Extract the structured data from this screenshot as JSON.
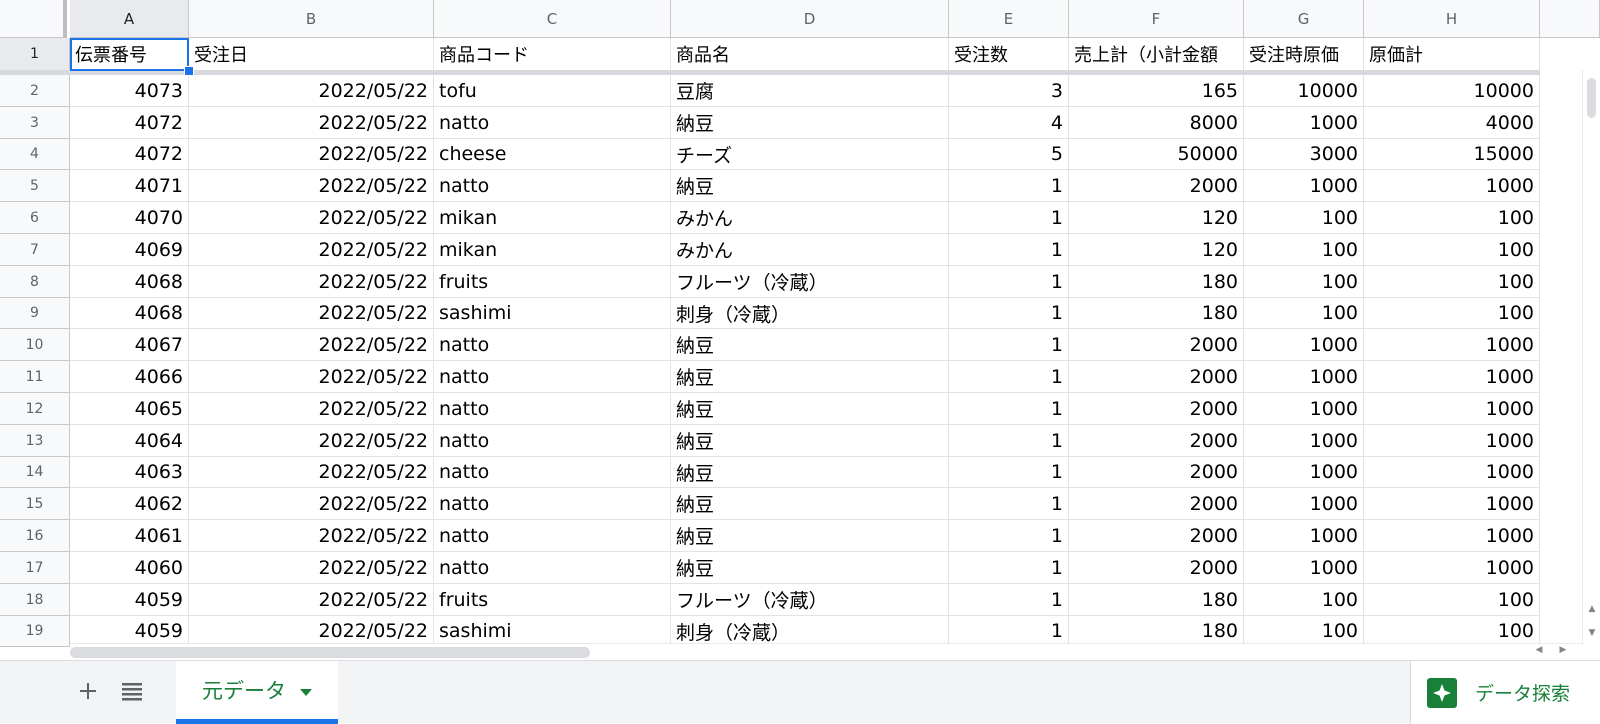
{
  "columns": [
    "A",
    "B",
    "C",
    "D",
    "E",
    "F",
    "G",
    "H"
  ],
  "header_row": {
    "number": "1",
    "cells": [
      "伝票番号",
      "受注日",
      "商品コード",
      "商品名",
      "受注数",
      "売上計（小計金額",
      "受注時原価",
      "原価計"
    ]
  },
  "rows": [
    {
      "n": "2",
      "cells": [
        "4073",
        "2022/05/22",
        "tofu",
        "豆腐",
        "3",
        "165",
        "10000",
        "10000"
      ]
    },
    {
      "n": "3",
      "cells": [
        "4072",
        "2022/05/22",
        "natto",
        "納豆",
        "4",
        "8000",
        "1000",
        "4000"
      ]
    },
    {
      "n": "4",
      "cells": [
        "4072",
        "2022/05/22",
        "cheese",
        "チーズ",
        "5",
        "50000",
        "3000",
        "15000"
      ]
    },
    {
      "n": "5",
      "cells": [
        "4071",
        "2022/05/22",
        "natto",
        "納豆",
        "1",
        "2000",
        "1000",
        "1000"
      ]
    },
    {
      "n": "6",
      "cells": [
        "4070",
        "2022/05/22",
        "mikan",
        "みかん",
        "1",
        "120",
        "100",
        "100"
      ]
    },
    {
      "n": "7",
      "cells": [
        "4069",
        "2022/05/22",
        "mikan",
        "みかん",
        "1",
        "120",
        "100",
        "100"
      ]
    },
    {
      "n": "8",
      "cells": [
        "4068",
        "2022/05/22",
        "fruits",
        "フルーツ（冷蔵）",
        "1",
        "180",
        "100",
        "100"
      ]
    },
    {
      "n": "9",
      "cells": [
        "4068",
        "2022/05/22",
        "sashimi",
        "刺身（冷蔵）",
        "1",
        "180",
        "100",
        "100"
      ]
    },
    {
      "n": "10",
      "cells": [
        "4067",
        "2022/05/22",
        "natto",
        "納豆",
        "1",
        "2000",
        "1000",
        "1000"
      ]
    },
    {
      "n": "11",
      "cells": [
        "4066",
        "2022/05/22",
        "natto",
        "納豆",
        "1",
        "2000",
        "1000",
        "1000"
      ]
    },
    {
      "n": "12",
      "cells": [
        "4065",
        "2022/05/22",
        "natto",
        "納豆",
        "1",
        "2000",
        "1000",
        "1000"
      ]
    },
    {
      "n": "13",
      "cells": [
        "4064",
        "2022/05/22",
        "natto",
        "納豆",
        "1",
        "2000",
        "1000",
        "1000"
      ]
    },
    {
      "n": "14",
      "cells": [
        "4063",
        "2022/05/22",
        "natto",
        "納豆",
        "1",
        "2000",
        "1000",
        "1000"
      ]
    },
    {
      "n": "15",
      "cells": [
        "4062",
        "2022/05/22",
        "natto",
        "納豆",
        "1",
        "2000",
        "1000",
        "1000"
      ]
    },
    {
      "n": "16",
      "cells": [
        "4061",
        "2022/05/22",
        "natto",
        "納豆",
        "1",
        "2000",
        "1000",
        "1000"
      ]
    },
    {
      "n": "17",
      "cells": [
        "4060",
        "2022/05/22",
        "natto",
        "納豆",
        "1",
        "2000",
        "1000",
        "1000"
      ]
    },
    {
      "n": "18",
      "cells": [
        "4059",
        "2022/05/22",
        "fruits",
        "フルーツ（冷蔵）",
        "1",
        "180",
        "100",
        "100"
      ]
    },
    {
      "n": "19",
      "cells": [
        "4059",
        "2022/05/22",
        "sashimi",
        "刺身（冷蔵）",
        "1",
        "180",
        "100",
        "100"
      ]
    }
  ],
  "numeric_columns": [
    0,
    1,
    4,
    5,
    6,
    7
  ],
  "selected_cell": "A1",
  "bottom_bar": {
    "add_sheet_icon": "plus-icon",
    "all_sheets_icon": "list-icon",
    "sheet_tab_label": "元データ",
    "explore_label": "データ探索"
  },
  "colors": {
    "accent": "#1a73e8",
    "tab_text": "#188038"
  }
}
